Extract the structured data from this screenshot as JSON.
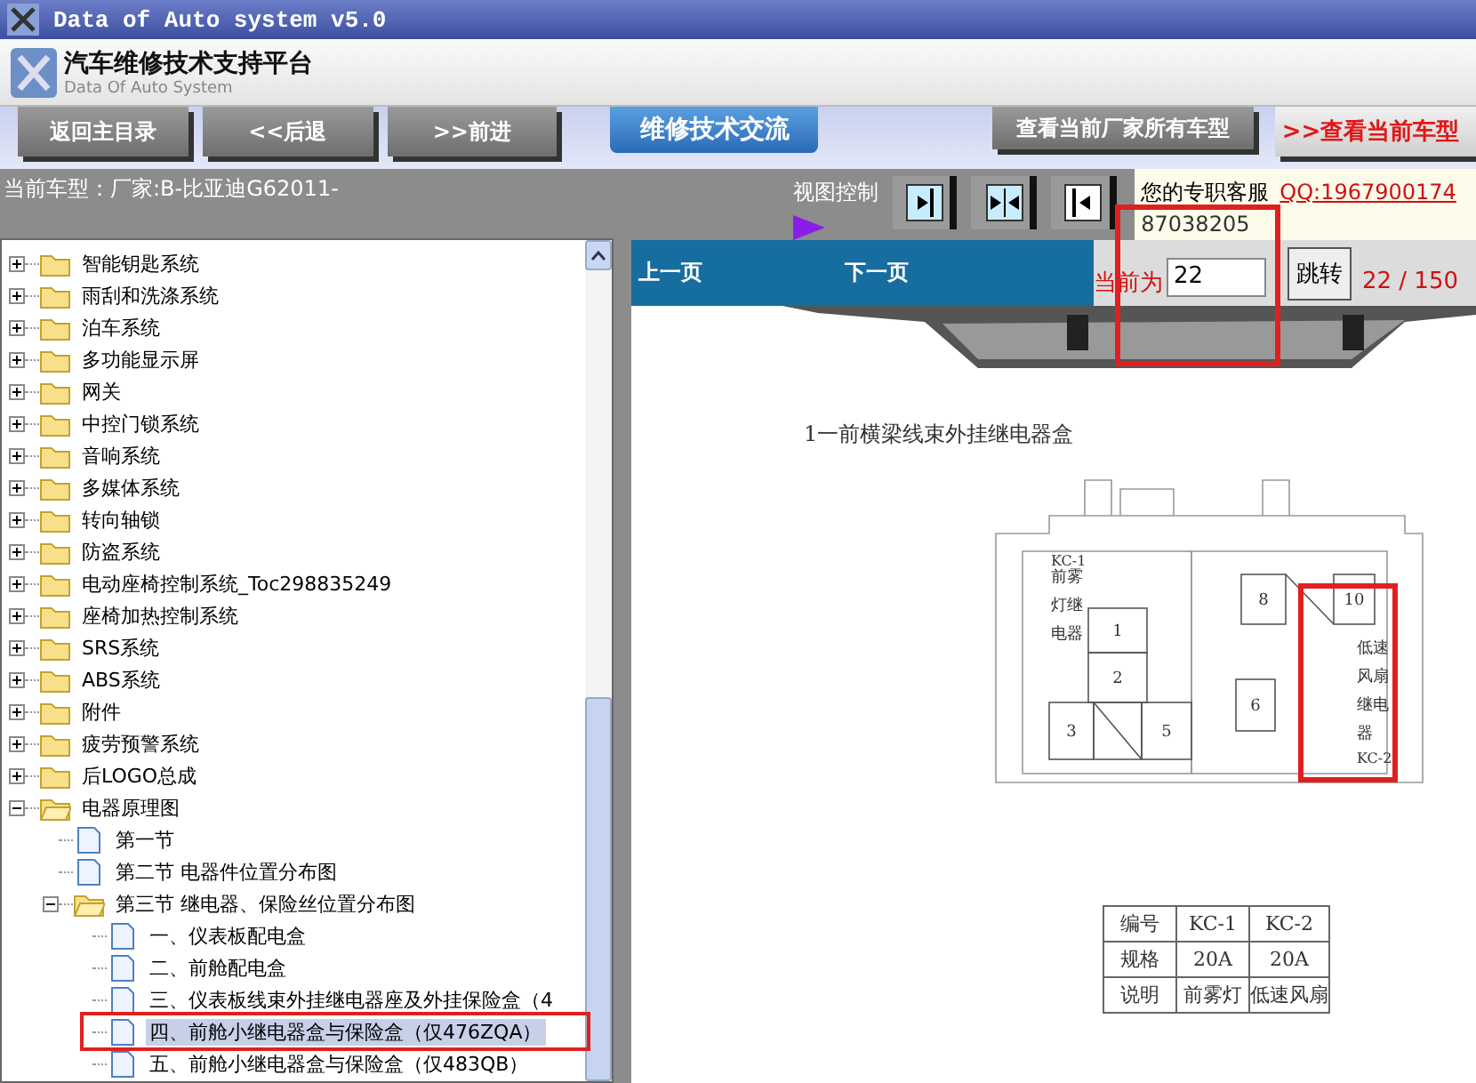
{
  "window": {
    "title": "Data of Auto system v5.0"
  },
  "header": {
    "title": "汽车维修技术支持平台",
    "subtitle": "Data Of Auto System"
  },
  "toolbar": {
    "buttons": [
      {
        "label": "返回主目录",
        "kind": "nav"
      },
      {
        "label": "<<后退",
        "kind": "nav"
      },
      {
        "label": ">>前进",
        "kind": "nav"
      },
      {
        "label": "维修技术交流",
        "kind": "tab"
      },
      {
        "label": "查看当前厂家所有车型",
        "kind": "wide"
      },
      {
        "label": ">>查看当前车型",
        "kind": "alert"
      }
    ]
  },
  "info_bar": {
    "current_model": "当前车型：厂家:B-比亚迪G62011-",
    "view_label": "视图控制",
    "view_buttons": [
      {
        "kind": "right"
      },
      {
        "kind": "both"
      },
      {
        "kind": "left"
      }
    ],
    "support": {
      "label": "您的专职客服",
      "qq": "QQ:1967900174",
      "phone": "87038205"
    }
  },
  "tree": [
    {
      "label": "智能钥匙系统",
      "kind": "folder",
      "expanded": false,
      "selected": false
    },
    {
      "label": "雨刮和洗涤系统",
      "kind": "folder",
      "expanded": false,
      "selected": false
    },
    {
      "label": "泊车系统",
      "kind": "folder",
      "expanded": false,
      "selected": false
    },
    {
      "label": "多功能显示屏",
      "kind": "folder",
      "expanded": false,
      "selected": false
    },
    {
      "label": "网关",
      "kind": "folder",
      "expanded": false,
      "selected": false
    },
    {
      "label": "中控门锁系统",
      "kind": "folder",
      "expanded": false,
      "selected": false
    },
    {
      "label": "音响系统",
      "kind": "folder",
      "expanded": false,
      "selected": false
    },
    {
      "label": "多媒体系统",
      "kind": "folder",
      "expanded": false,
      "selected": false
    },
    {
      "label": "转向轴锁",
      "kind": "folder",
      "expanded": false,
      "selected": false
    },
    {
      "label": "防盗系统",
      "kind": "folder",
      "expanded": false,
      "selected": false
    },
    {
      "label": "电动座椅控制系统_Toc298835249",
      "kind": "folder",
      "expanded": false,
      "selected": false
    },
    {
      "label": "座椅加热控制系统",
      "kind": "folder",
      "expanded": false,
      "selected": false
    },
    {
      "label": " SRS系统",
      "kind": "folder",
      "expanded": false,
      "selected": false
    },
    {
      "label": "ABS系统",
      "kind": "folder",
      "expanded": false,
      "selected": false
    },
    {
      "label": "附件",
      "kind": "folder",
      "expanded": false,
      "selected": false
    },
    {
      "label": "疲劳预警系统",
      "kind": "folder",
      "expanded": false,
      "selected": false
    },
    {
      "label": " 后LOGO总成",
      "kind": "folder",
      "expanded": false,
      "selected": false
    },
    {
      "label": "电器原理图",
      "kind": "folder",
      "expanded": true,
      "selected": false,
      "children": [
        {
          "label": "第一节",
          "kind": "page",
          "selected": false
        },
        {
          "label": "第二节 电器件位置分布图",
          "kind": "page",
          "selected": false
        },
        {
          "label": "第三节 继电器、保险丝位置分布图",
          "kind": "folder",
          "expanded": true,
          "selected": false,
          "children": [
            {
              "label": "一、仪表板配电盒",
              "kind": "page",
              "selected": false
            },
            {
              "label": "二、前舱配电盒",
              "kind": "page",
              "selected": false
            },
            {
              "label": "三、仪表板线束外挂继电器座及外挂保险盒（4",
              "kind": "page",
              "selected": false
            },
            {
              "label": "四、前舱小继电器盒与保险盒（仅476ZQA）",
              "kind": "page",
              "selected": true
            },
            {
              "label": "五、前舱小继电器盒与保险盒（仅483QB）",
              "kind": "page",
              "selected": false
            }
          ]
        }
      ]
    }
  ],
  "pager": {
    "prev": "上一页",
    "next": "下一页",
    "current_label": "当前为",
    "page_value": "22",
    "jump_button": "跳转",
    "page_count": "22 / 150"
  },
  "document": {
    "caption": "1一前横梁线束外挂继电器盒",
    "slots": [
      "1",
      "2",
      "3",
      "5",
      "6",
      "8",
      "10"
    ],
    "relays": [
      {
        "code": "KC-1",
        "name": "前雾灯继电器"
      },
      {
        "code": "KC-2",
        "name": "低速风扇继电器"
      }
    ],
    "table": [
      [
        "编号",
        "KC-1",
        "KC-2"
      ],
      [
        "规格",
        "20A",
        "20A"
      ],
      [
        "说明",
        "前雾灯",
        "低速风扇"
      ]
    ]
  }
}
